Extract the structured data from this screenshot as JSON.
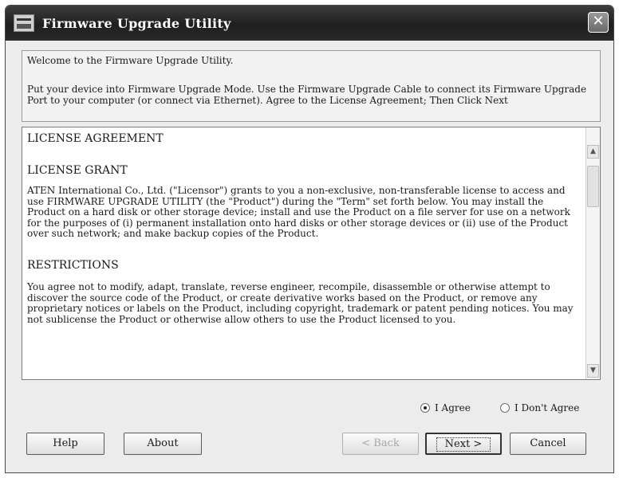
{
  "window": {
    "title": "Firmware Upgrade Utility",
    "close_glyph": "✕"
  },
  "intro": {
    "line1": "Welcome to the Firmware Upgrade Utility.",
    "line2": "Put your device into Firmware Upgrade Mode. Use the Firmware Upgrade Cable to connect its Firmware Upgrade Port to your computer (or connect via Ethernet). Agree to the License Agreement; Then Click Next"
  },
  "license": {
    "heading1": "LICENSE AGREEMENT",
    "heading2": "LICENSE GRANT",
    "grant_text": "ATEN International Co., Ltd. (\"Licensor\") grants to you a non-exclusive, non-transferable license to access and use FIRMWARE UPGRADE UTILITY (the \"Product\") during the \"Term\" set forth below. You may install the Product on a hard disk or other storage device; install and use the Product on a file server for use on a network for the purposes of (i) permanent installation onto hard disks or other storage devices or (ii) use of the Product over such network; and make backup copies of the Product.",
    "heading3": "RESTRICTIONS",
    "restrictions_text": "You agree not to modify, adapt, translate, reverse engineer, recompile, disassemble or otherwise attempt to discover the source code of the Product, or create derivative works based on the Product, or remove any proprietary notices or labels on the Product, including copyright, trademark or patent pending notices. You may not sublicense the Product or otherwise allow others to use the Product licensed to you."
  },
  "agreement": {
    "agree_label": "I Agree",
    "disagree_label": "I Don't Agree",
    "selected": "agree"
  },
  "buttons": {
    "help": "Help",
    "about": "About",
    "back": "< Back",
    "next": "Next >",
    "cancel": "Cancel"
  },
  "icons": {
    "app": "firmware-app-icon",
    "close": "close-icon",
    "scroll_up": "scroll-up-arrow-icon",
    "scroll_down": "scroll-down-arrow-icon"
  },
  "colors": {
    "titlebar": "#2a2a2a",
    "window_bg": "#ececec"
  }
}
